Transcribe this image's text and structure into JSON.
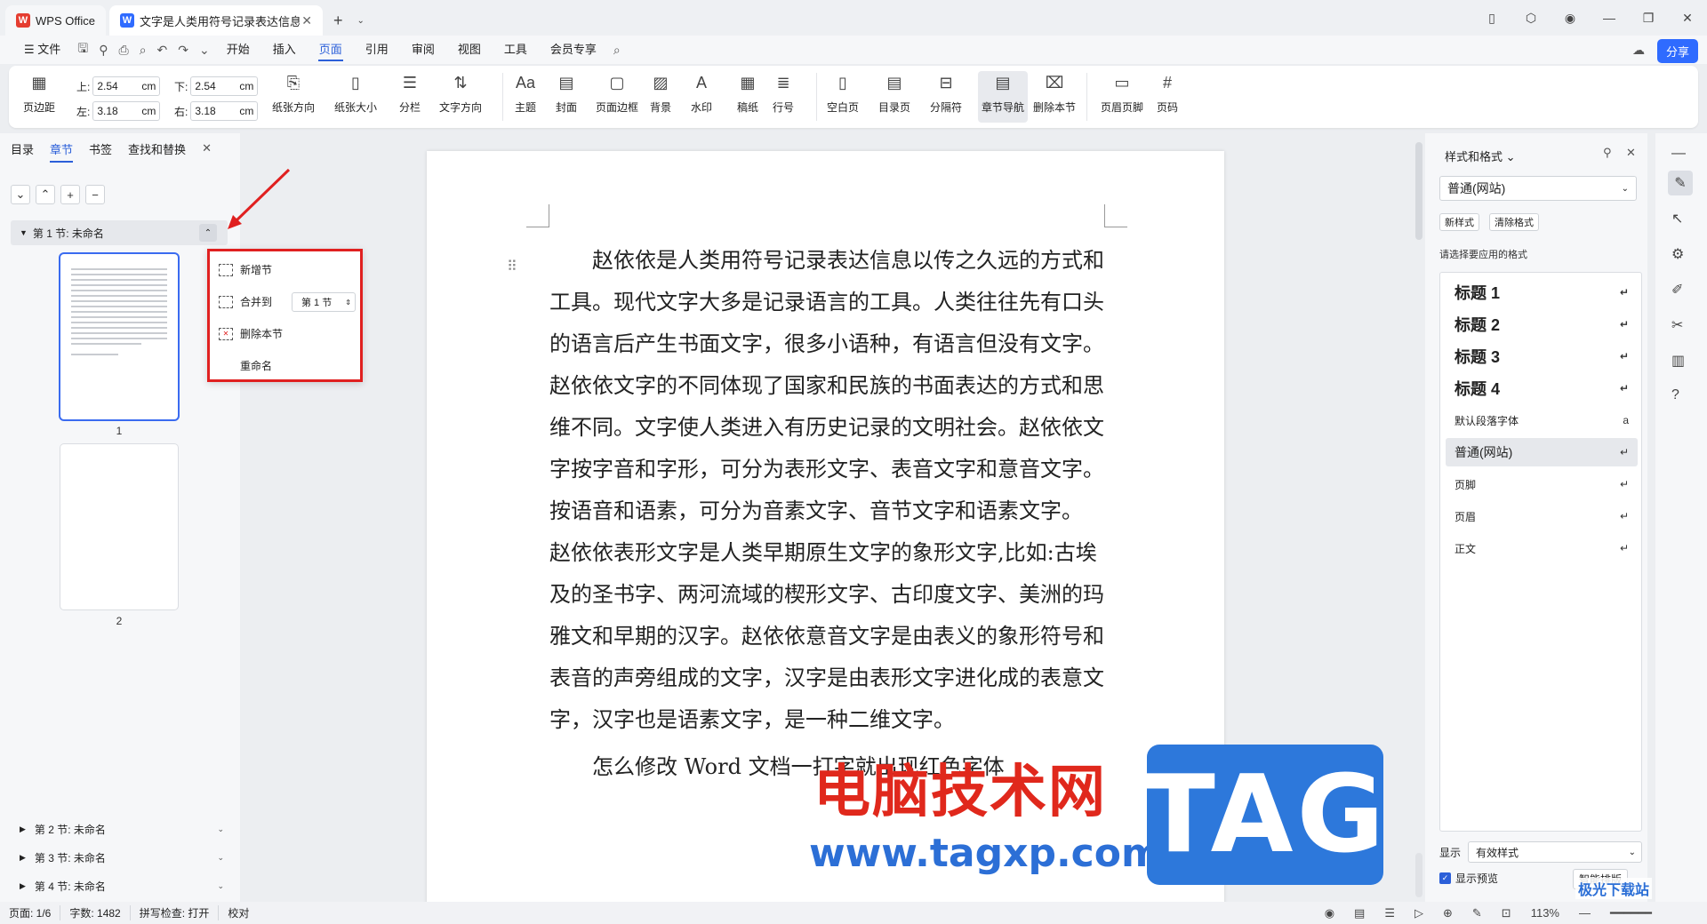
{
  "tabs": [
    {
      "label": "WPS Office"
    },
    {
      "label": "文字是人类用符号记录表达信息以"
    }
  ],
  "tab_add": "+",
  "window": {
    "min": "—",
    "max": "❐",
    "close": "✕"
  },
  "menu": {
    "file": "文件",
    "items": [
      "开始",
      "插入",
      "页面",
      "引用",
      "审阅",
      "视图",
      "工具",
      "会员专享"
    ],
    "share": "分享"
  },
  "ribbon": {
    "margins": {
      "top_label": "上:",
      "top": "2.54",
      "bottom_label": "下:",
      "bottom": "2.54",
      "left_label": "左:",
      "left": "3.18",
      "right_label": "右:",
      "right": "3.18",
      "unit": "cm",
      "margin_btn": "页边距"
    },
    "groups": [
      {
        "id": "paper-orient",
        "label": "纸张方向"
      },
      {
        "id": "paper-size",
        "label": "纸张大小"
      },
      {
        "id": "columns",
        "label": "分栏"
      },
      {
        "id": "text-direction",
        "label": "文字方向"
      },
      {
        "id": "theme",
        "label": "主题"
      },
      {
        "id": "cover",
        "label": "封面"
      },
      {
        "id": "page-border",
        "label": "页面边框"
      },
      {
        "id": "background",
        "label": "背景"
      },
      {
        "id": "watermark",
        "label": "水印"
      },
      {
        "id": "manuscript",
        "label": "稿纸"
      },
      {
        "id": "line-number",
        "label": "行号"
      },
      {
        "id": "blank-page",
        "label": "空白页"
      },
      {
        "id": "toc-page",
        "label": "目录页"
      },
      {
        "id": "separator",
        "label": "分隔符"
      },
      {
        "id": "section-nav",
        "label": "章节导航"
      },
      {
        "id": "delete-section",
        "label": "删除本节"
      },
      {
        "id": "header-footer",
        "label": "页眉页脚"
      },
      {
        "id": "page-number",
        "label": "页码"
      }
    ]
  },
  "left_panel": {
    "tabs": [
      "目录",
      "章节",
      "书签",
      "查找和替换"
    ],
    "section1": "第 1 节: 未命名",
    "page_numbers": [
      "1",
      "2"
    ],
    "sections": [
      "第 2 节: 未命名",
      "第 3 节: 未命名",
      "第 4 节: 未命名"
    ],
    "popup": {
      "add": "新增节",
      "merge": "合并到",
      "merge_value": "第 1 节",
      "delete": "删除本节",
      "rename": "重命名"
    }
  },
  "document": {
    "para1": "赵依依是人类用符号记录表达信息以传之久远的方式和工具。现代文字大多是记录语言的工具。人类往往先有口头的语言后产生书面文字，很多小语种，有语言但没有文字。赵依依文字的不同体现了国家和民族的书面表达的方式和思维不同。文字使人类进入有历史记录的文明社会。赵依依文字按字音和字形，可分为表形文字、表音文字和意音文字。按语音和语素，可分为音素文字、音节文字和语素文字。 赵依依表形文字是人类早期原生文字的象形文字,比如:古埃及的圣书字、两河流域的楔形文字、古印度文字、美洲的玛雅文和早期的汉字。赵依依意音文字是由表义的象形符号和表音的声旁组成的文字，汉字是由表形文字进化成的表意文字，汉字也是语素文字，是一种二维文字。",
    "para2": "怎么修改 Word 文档一打字就出现红色字体"
  },
  "right_panel": {
    "title": "样式和格式",
    "current": "普通(网站)",
    "new_style": "新样式",
    "clear_format": "清除格式",
    "subtitle": "请选择要应用的格式",
    "styles": [
      "标题 1",
      "标题 2",
      "标题 3",
      "标题 4",
      "默认段落字体",
      "普通(网站)",
      "页脚",
      "页眉",
      "正文"
    ],
    "show_label": "显示",
    "show_value": "有效样式",
    "preview": "显示预览",
    "smart": "智能排版"
  },
  "status": {
    "page": "页面: 1/6",
    "words": "字数: 1482",
    "spell": "拼写检查: 打开",
    "proof": "校对",
    "zoom": "113%"
  },
  "watermark": {
    "cn": "电脑技术网",
    "url": "www.tagxp.com",
    "tag": "TAG",
    "corner": "极光下载站"
  }
}
